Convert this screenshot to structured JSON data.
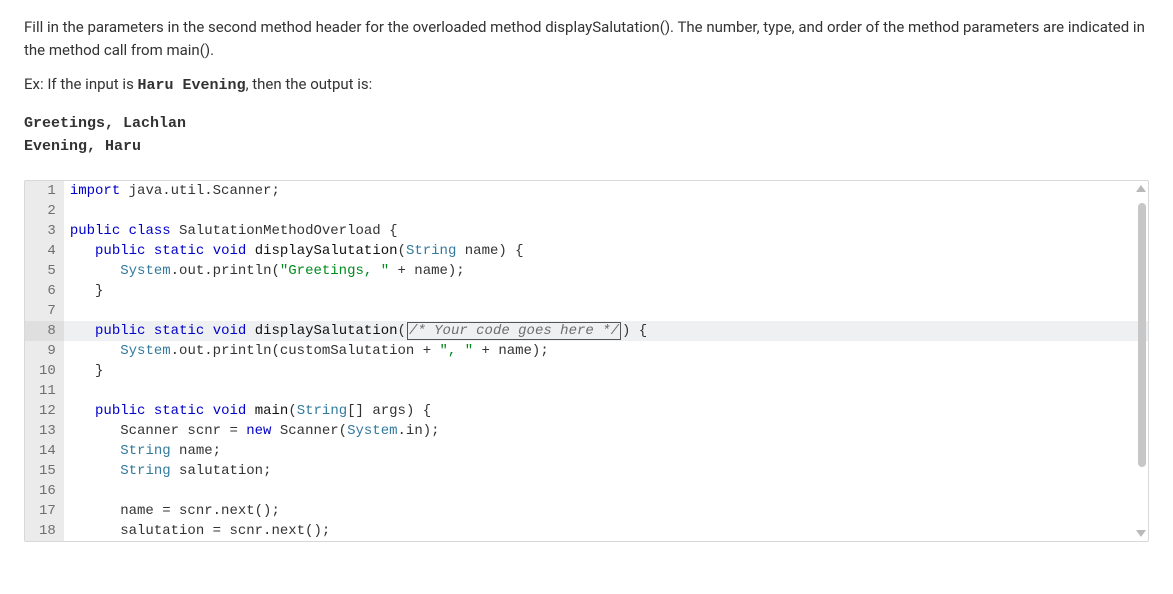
{
  "intro": "Fill in the parameters in the second method header for the overloaded method displaySalutation(). The number, type, and order of the method parameters are indicated in the method call from main().",
  "example_prefix": "Ex: If the input is ",
  "example_input": "Haru Evening",
  "example_suffix": ", then the output is:",
  "output": "Greetings, Lachlan\nEvening, Haru",
  "code": {
    "lines": [
      {
        "n": 1,
        "tokens": [
          [
            "kw",
            "import"
          ],
          [
            "",
            " java.util.Scanner;"
          ]
        ]
      },
      {
        "n": 2,
        "tokens": []
      },
      {
        "n": 3,
        "tokens": [
          [
            "kw",
            "public"
          ],
          [
            "",
            " "
          ],
          [
            "kw",
            "class"
          ],
          [
            "",
            " SalutationMethodOverload {"
          ]
        ]
      },
      {
        "n": 4,
        "tokens": [
          [
            "",
            "   "
          ],
          [
            "kw",
            "public"
          ],
          [
            "",
            " "
          ],
          [
            "kw",
            "static"
          ],
          [
            "",
            " "
          ],
          [
            "kw",
            "void"
          ],
          [
            "",
            " "
          ],
          [
            "fn",
            "displaySalutation"
          ],
          [
            "",
            "("
          ],
          [
            "typ",
            "String"
          ],
          [
            "",
            " name) {"
          ]
        ]
      },
      {
        "n": 5,
        "tokens": [
          [
            "",
            "      "
          ],
          [
            "typ",
            "System"
          ],
          [
            "",
            ".out.println("
          ],
          [
            "str",
            "\"Greetings, \""
          ],
          [
            "",
            " + name);"
          ]
        ]
      },
      {
        "n": 6,
        "tokens": [
          [
            "",
            "   }"
          ]
        ]
      },
      {
        "n": 7,
        "tokens": []
      },
      {
        "n": 8,
        "hl": true,
        "tokens": [
          [
            "",
            "   "
          ],
          [
            "kw",
            "public"
          ],
          [
            "",
            " "
          ],
          [
            "kw",
            "static"
          ],
          [
            "",
            " "
          ],
          [
            "kw",
            "void"
          ],
          [
            "",
            " "
          ],
          [
            "fn",
            "displaySalutation"
          ],
          [
            "",
            "("
          ],
          [
            "cursor",
            ""
          ],
          [
            "cmt",
            "/* Your code goes here */"
          ],
          [
            "cursorend",
            ""
          ],
          [
            "",
            " {"
          ]
        ]
      },
      {
        "n": 9,
        "tokens": [
          [
            "",
            "      "
          ],
          [
            "typ",
            "System"
          ],
          [
            "",
            ".out.println(customSalutation + "
          ],
          [
            "str",
            "\", \""
          ],
          [
            "",
            " + name);"
          ]
        ]
      },
      {
        "n": 10,
        "tokens": [
          [
            "",
            "   }"
          ]
        ]
      },
      {
        "n": 11,
        "tokens": []
      },
      {
        "n": 12,
        "tokens": [
          [
            "",
            "   "
          ],
          [
            "kw",
            "public"
          ],
          [
            "",
            " "
          ],
          [
            "kw",
            "static"
          ],
          [
            "",
            " "
          ],
          [
            "kw",
            "void"
          ],
          [
            "",
            " "
          ],
          [
            "fn",
            "main"
          ],
          [
            "",
            "("
          ],
          [
            "typ",
            "String"
          ],
          [
            "",
            "[] args) {"
          ]
        ]
      },
      {
        "n": 13,
        "tokens": [
          [
            "",
            "      Scanner scnr = "
          ],
          [
            "kw",
            "new"
          ],
          [
            "",
            " Scanner("
          ],
          [
            "typ",
            "System"
          ],
          [
            "",
            ".in);"
          ]
        ]
      },
      {
        "n": 14,
        "tokens": [
          [
            "",
            "      "
          ],
          [
            "typ",
            "String"
          ],
          [
            "",
            " name;"
          ]
        ]
      },
      {
        "n": 15,
        "tokens": [
          [
            "",
            "      "
          ],
          [
            "typ",
            "String"
          ],
          [
            "",
            " salutation;"
          ]
        ]
      },
      {
        "n": 16,
        "tokens": []
      },
      {
        "n": 17,
        "tokens": [
          [
            "",
            "      name = scnr.next();"
          ]
        ]
      },
      {
        "n": 18,
        "tokens": [
          [
            "",
            "      salutation = scnr.next();"
          ]
        ]
      }
    ]
  }
}
